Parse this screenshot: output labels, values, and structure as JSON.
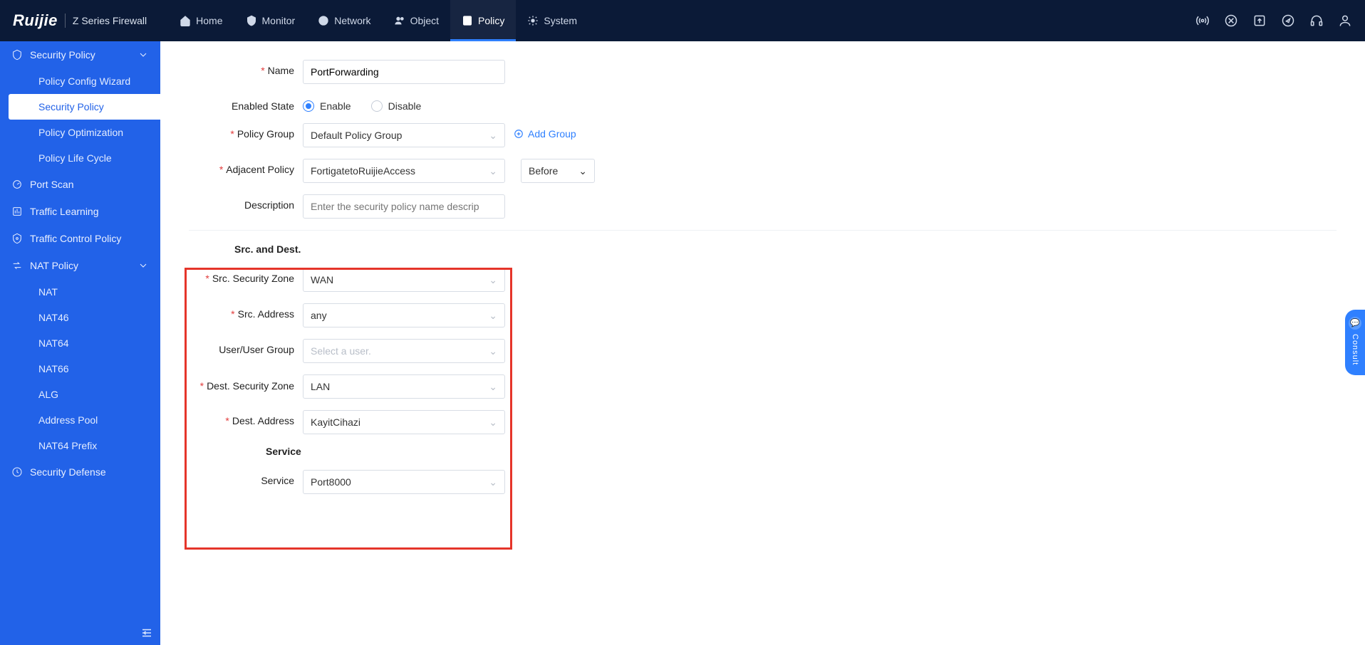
{
  "brand": {
    "logo": "Ruijie",
    "subtitle": "Z Series Firewall"
  },
  "nav": {
    "home": "Home",
    "monitor": "Monitor",
    "network": "Network",
    "object": "Object",
    "policy": "Policy",
    "system": "System"
  },
  "sidebar": {
    "security_policy": "Security Policy",
    "children": {
      "wizard": "Policy Config Wizard",
      "security_policy": "Security Policy",
      "optimization": "Policy Optimization",
      "life_cycle": "Policy Life Cycle"
    },
    "port_scan": "Port Scan",
    "traffic_learning": "Traffic Learning",
    "traffic_control": "Traffic Control Policy",
    "nat_policy": "NAT Policy",
    "nat_children": {
      "nat": "NAT",
      "nat46": "NAT46",
      "nat64": "NAT64",
      "nat66": "NAT66",
      "alg": "ALG",
      "address_pool": "Address Pool",
      "nat64_prefix": "NAT64 Prefix"
    },
    "security_defense": "Security Defense"
  },
  "form": {
    "name_label": "Name",
    "name_value": "PortForwarding",
    "enabled_label": "Enabled State",
    "enable": "Enable",
    "disable": "Disable",
    "policy_group_label": "Policy Group",
    "policy_group_value": "Default Policy Group",
    "add_group": "Add Group",
    "adjacent_label": "Adjacent Policy",
    "adjacent_value": "FortigatetoRuijieAccess",
    "adjacent_pos": "Before",
    "description_label": "Description",
    "description_placeholder": "Enter the security policy name descrip",
    "section_src_dest": "Src. and Dest.",
    "src_zone_label": "Src. Security Zone",
    "src_zone_value": "WAN",
    "src_addr_label": "Src. Address",
    "src_addr_value": "any",
    "user_group_label": "User/User Group",
    "user_group_placeholder": "Select a user.",
    "dest_zone_label": "Dest. Security Zone",
    "dest_zone_value": "LAN",
    "dest_addr_label": "Dest. Address",
    "dest_addr_value": "KayitCihazi",
    "section_service": "Service",
    "service_label": "Service",
    "service_value": "Port8000"
  },
  "consult": "Consult"
}
